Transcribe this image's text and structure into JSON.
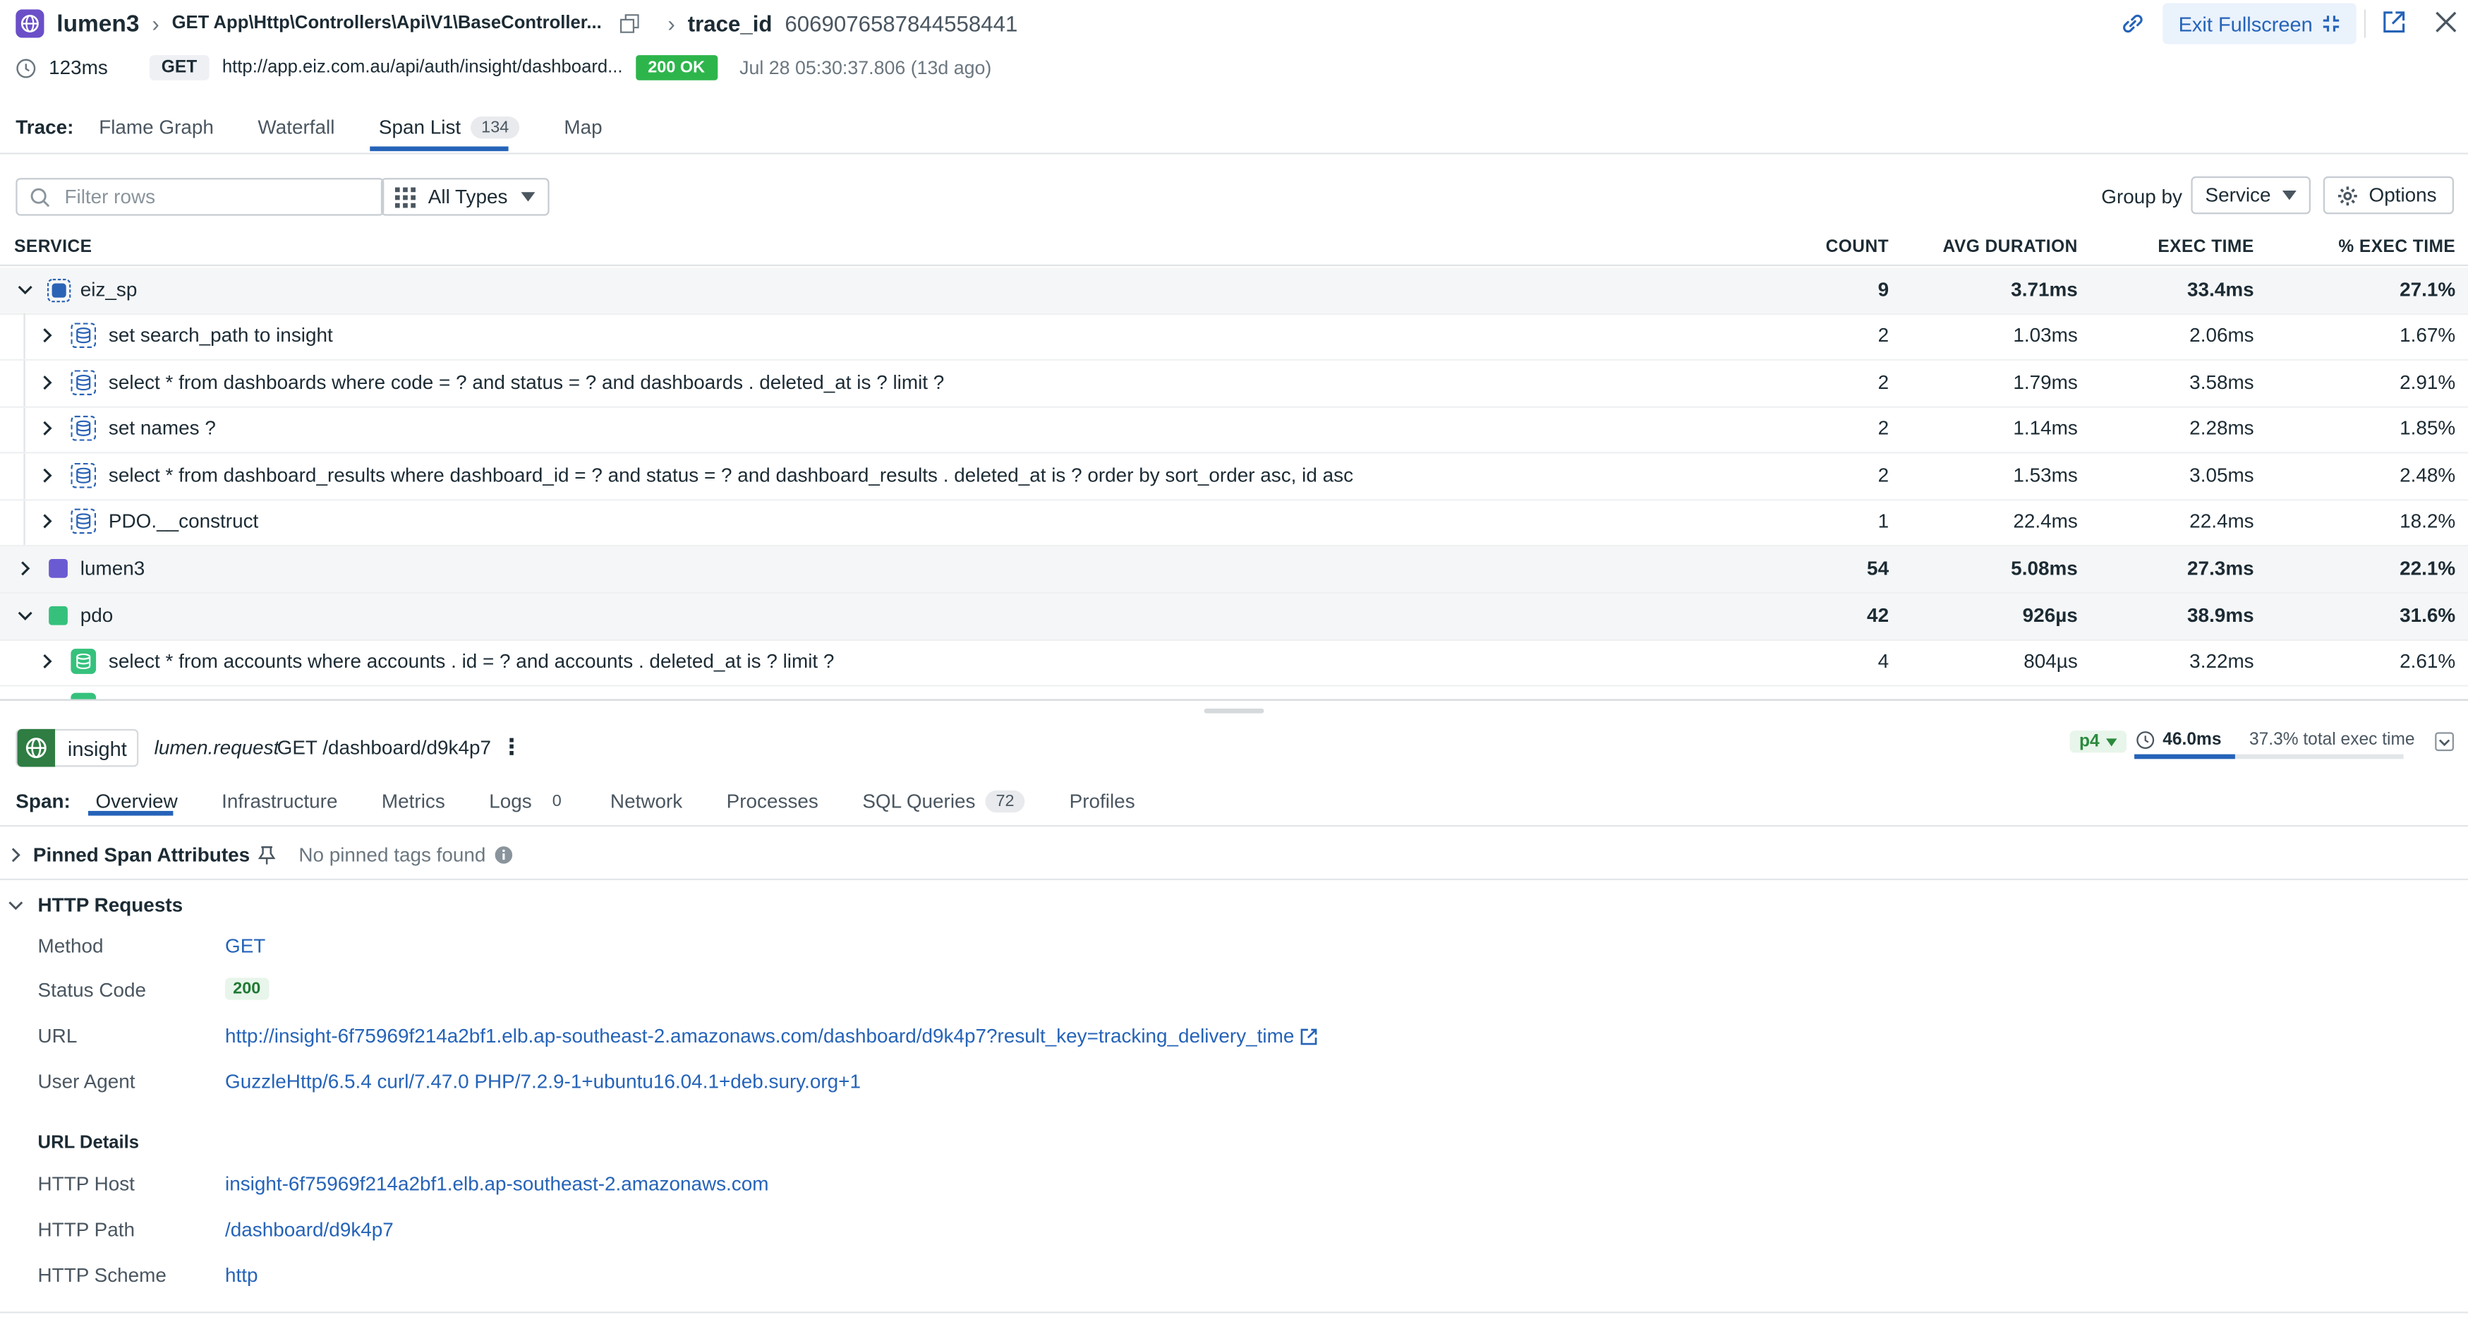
{
  "header": {
    "service": "lumen3",
    "resource": "GET App\\Http\\Controllers\\Api\\V1\\BaseController...",
    "trace_label": "trace_id",
    "trace_id": "6069076587844558441",
    "exit_fullscreen": "Exit Fullscreen",
    "duration": "123ms",
    "method": "GET",
    "url": "http://app.eiz.com.au/api/auth/insight/dashboard...",
    "status": "200 OK",
    "timestamp": "Jul 28 05:30:37.806 (13d ago)"
  },
  "trace_tabs": {
    "label": "Trace:",
    "items": [
      "Flame Graph",
      "Waterfall",
      "Span List",
      "Map"
    ],
    "span_list_count": "134"
  },
  "toolbar": {
    "filter_placeholder": "Filter rows",
    "type_select": "All Types",
    "group_by_label": "Group by",
    "group_by_value": "Service",
    "options": "Options"
  },
  "table": {
    "columns": [
      "SERVICE",
      "COUNT",
      "AVG DURATION",
      "EXEC TIME",
      "% EXEC TIME"
    ],
    "rows": [
      {
        "name": "eiz_sp",
        "count": "9",
        "avg": "3.71ms",
        "exec": "33.4ms",
        "pct": "27.1%"
      },
      {
        "name": "set search_path to insight",
        "count": "2",
        "avg": "1.03ms",
        "exec": "2.06ms",
        "pct": "1.67%"
      },
      {
        "name": "select * from dashboards where code = ? and status = ? and dashboards . deleted_at is ? limit ?",
        "count": "2",
        "avg": "1.79ms",
        "exec": "3.58ms",
        "pct": "2.91%"
      },
      {
        "name": "set names ?",
        "count": "2",
        "avg": "1.14ms",
        "exec": "2.28ms",
        "pct": "1.85%"
      },
      {
        "name": "select * from dashboard_results where dashboard_id = ? and status = ? and dashboard_results . deleted_at is ? order by sort_order asc, id asc",
        "count": "2",
        "avg": "1.53ms",
        "exec": "3.05ms",
        "pct": "2.48%"
      },
      {
        "name": "PDO.__construct",
        "count": "1",
        "avg": "22.4ms",
        "exec": "22.4ms",
        "pct": "18.2%"
      },
      {
        "name": "lumen3",
        "count": "54",
        "avg": "5.08ms",
        "exec": "27.3ms",
        "pct": "22.1%"
      },
      {
        "name": "pdo",
        "count": "42",
        "avg": "926µs",
        "exec": "38.9ms",
        "pct": "31.6%"
      },
      {
        "name": "select * from accounts where accounts . id = ? and accounts . deleted_at is ? limit ?",
        "count": "4",
        "avg": "804µs",
        "exec": "3.22ms",
        "pct": "2.61%"
      }
    ]
  },
  "span": {
    "service": "insight",
    "operation": "lumen.request",
    "resource": "GET /dashboard/d9k4p7",
    "priority": "p4",
    "duration": "46.0ms",
    "exec_share": "37.3% total exec time",
    "exec_fraction": 0.373,
    "tabs_label": "Span:",
    "tabs": [
      "Overview",
      "Infrastructure",
      "Metrics",
      "Logs",
      "Network",
      "Processes",
      "SQL Queries",
      "Profiles"
    ],
    "logs_count": "0",
    "sql_count": "72"
  },
  "pinned": {
    "title": "Pinned Span Attributes",
    "empty": "No pinned tags found"
  },
  "http": {
    "title": "HTTP Requests",
    "fields": [
      {
        "key": "Method",
        "value": "GET"
      },
      {
        "key": "Status Code",
        "value": "200"
      },
      {
        "key": "URL",
        "value": "http://insight-6f75969f214a2bf1.elb.ap-southeast-2.amazonaws.com/dashboard/d9k4p7?result_key=tracking_delivery_time"
      },
      {
        "key": "User Agent",
        "value": "GuzzleHttp/6.5.4 curl/7.47.0 PHP/7.2.9-1+ubuntu16.04.1+deb.sury.org+1"
      }
    ],
    "url_details_title": "URL Details",
    "url_details": [
      {
        "key": "HTTP Host",
        "value": "insight-6f75969f214a2bf1.elb.ap-southeast-2.amazonaws.com"
      },
      {
        "key": "HTTP Path",
        "value": "/dashboard/d9k4p7"
      },
      {
        "key": "HTTP Scheme",
        "value": "http"
      }
    ]
  },
  "colors": {
    "accent": "#2563b8",
    "service_purple": "#6a4fc8",
    "lumen_purple": "#6b5bd2",
    "pdo_green": "#35c17c",
    "eiz_blue": "#2a62b5",
    "ok_green": "#2db54b"
  }
}
